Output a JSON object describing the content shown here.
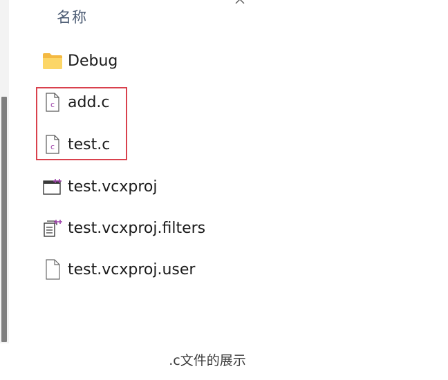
{
  "header": {
    "column_name": "名称"
  },
  "files": [
    {
      "name": "Debug",
      "icon": "folder-icon"
    },
    {
      "name": "add.c",
      "icon": "c-file-icon"
    },
    {
      "name": "test.c",
      "icon": "c-file-icon"
    },
    {
      "name": "test.vcxproj",
      "icon": "vcxproj-icon"
    },
    {
      "name": "test.vcxproj.filters",
      "icon": "filters-icon"
    },
    {
      "name": "test.vcxproj.user",
      "icon": "blank-file-icon"
    }
  ],
  "caption": ".c文件的展示",
  "colors": {
    "highlight": "#d9414d",
    "folder": "#f7c948",
    "c_accent": "#9b3fa8"
  }
}
